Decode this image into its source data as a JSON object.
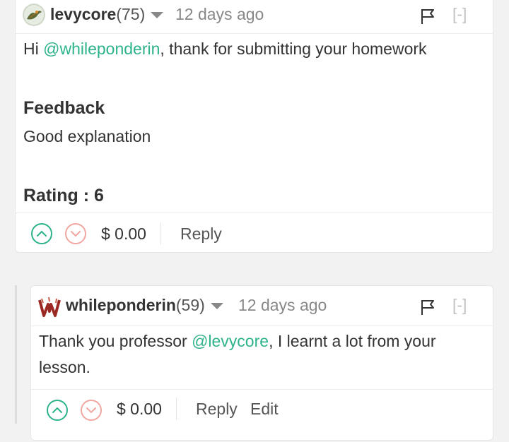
{
  "comments": [
    {
      "author": "levycore",
      "reputation": "(75)",
      "time": "12 days ago",
      "collapse": "[-]",
      "greeting_prefix": "Hi ",
      "mention": "@whileponderin",
      "greeting_suffix": ", thank for submitting your homework",
      "feedback_heading": "Feedback",
      "feedback_text": "Good explanation",
      "rating": "Rating : 6",
      "payout": "$ 0.00",
      "reply_label": "Reply"
    },
    {
      "author": "whileponderin",
      "reputation": "(59)",
      "time": "12 days ago",
      "collapse": "[-]",
      "text_prefix": "Thank you professor ",
      "mention": "@levycore",
      "text_suffix": ", I learnt a lot from your lesson.",
      "payout": "$ 0.00",
      "reply_label": "Reply",
      "edit_label": "Edit"
    }
  ],
  "colors": {
    "accent": "#2db38b",
    "downvote": "#f1a7a0",
    "muted": "#888888"
  },
  "icons": [
    "upvote-icon",
    "downvote-icon",
    "flag-icon",
    "dropdown-caret-icon"
  ]
}
